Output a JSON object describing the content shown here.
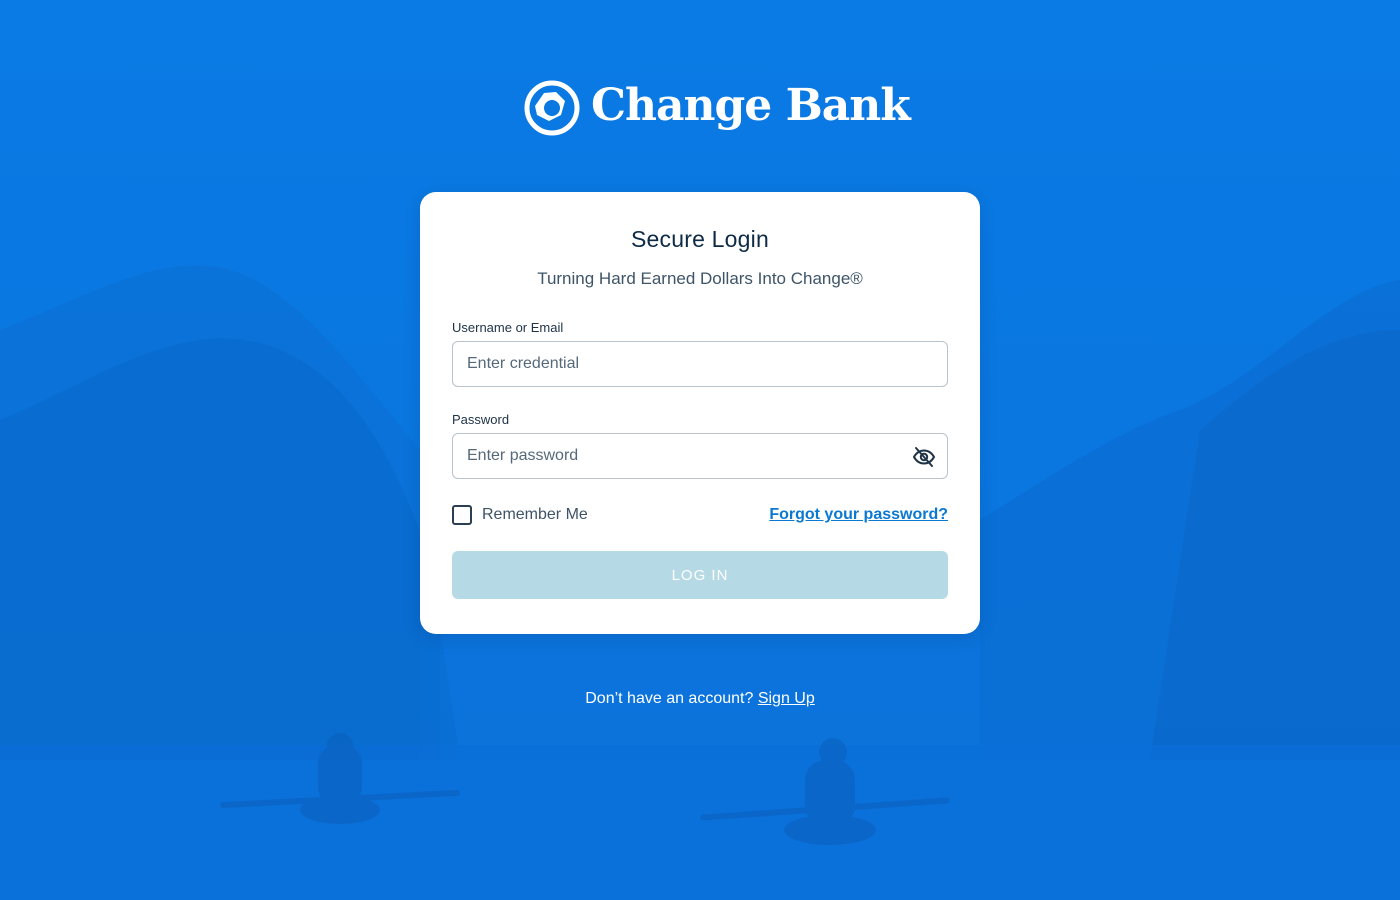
{
  "brand": {
    "name": "Change Bank",
    "logo_icon": "change-bank-globe-icon"
  },
  "login_card": {
    "title": "Secure Login",
    "subtitle": "Turning Hard Earned Dollars Into Change®",
    "username": {
      "label": "Username or Email",
      "value": "",
      "placeholder": "Enter credential"
    },
    "password": {
      "label": "Password",
      "value": "",
      "placeholder": "Enter password",
      "toggle_icon": "eye-slash-icon"
    },
    "remember_me": {
      "label": "Remember Me",
      "checked": false
    },
    "forgot_password_label": "Forgot your password?",
    "login_button_label": "LOG IN"
  },
  "signup": {
    "prompt": "Don’t have an account?",
    "link_label": "Sign Up"
  },
  "colors": {
    "background": "#0a78e0",
    "card": "#ffffff",
    "link": "#0b78d1",
    "button_disabled": "#b5dae5",
    "title_text": "#0e2a45"
  }
}
